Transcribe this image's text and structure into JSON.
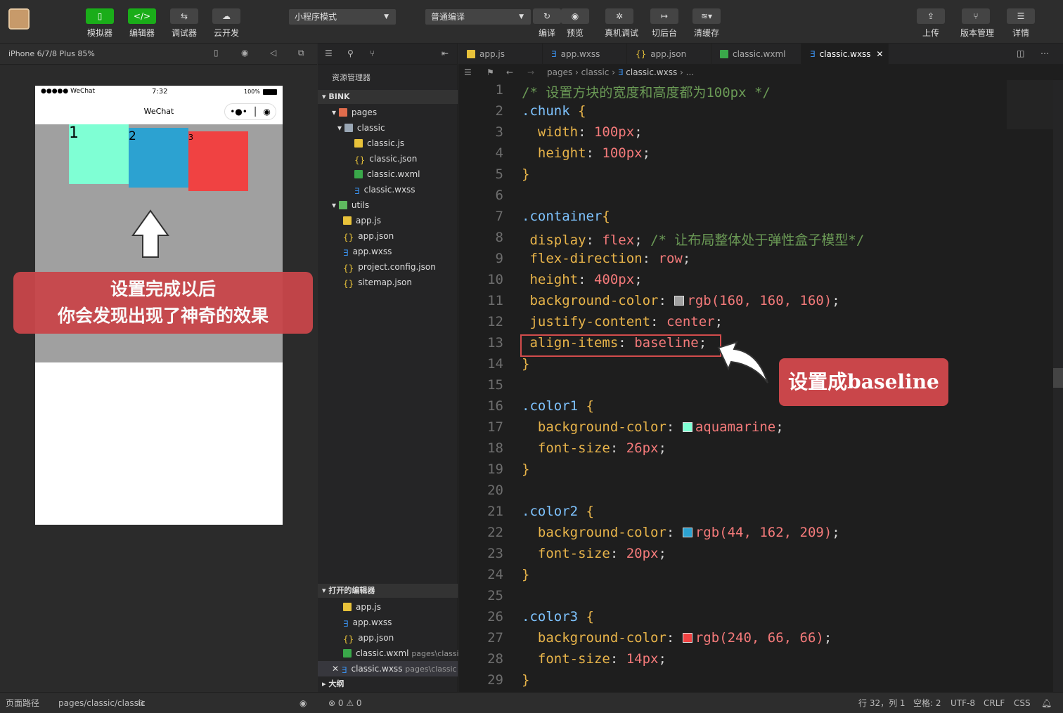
{
  "toolbar": {
    "simulator": "模拟器",
    "editor": "编辑器",
    "debugger": "调试器",
    "cloud": "云开发",
    "mode": "小程序模式",
    "compile": "普通编译",
    "compile_btn": "编译",
    "preview": "预览",
    "real_debug": "真机调试",
    "background": "切后台",
    "clear_cache": "清缓存",
    "upload": "上传",
    "version": "版本管理",
    "details": "详情"
  },
  "sim": {
    "device": "iPhone 6/7/8 Plus 85%",
    "status_left": "●●●●● WeChat",
    "time": "7:32",
    "battery": "100%",
    "nav_title": "WeChat",
    "blocks": [
      {
        "label": "1"
      },
      {
        "label": "2"
      },
      {
        "label": "3"
      }
    ],
    "banner_line1": "设置完成以后",
    "banner_line2": "你会发现出现了神奇的效果"
  },
  "explorer": {
    "title": "资源管理器",
    "project": "BINK",
    "tree": [
      "pages",
      "classic",
      "classic.js",
      "classic.json",
      "classic.wxml",
      "classic.wxss",
      "utils",
      "app.js",
      "app.json",
      "app.wxss",
      "project.config.json",
      "sitemap.json"
    ],
    "open_editors_title": "打开的编辑器",
    "open_editors": [
      "app.js",
      "app.wxss",
      "app.json",
      "classic.wxml",
      "classic.wxss"
    ],
    "open_hint": "pages\\classic",
    "outline": "大纲"
  },
  "tabs": [
    "app.js",
    "app.wxss",
    "app.json",
    "classic.wxml",
    "classic.wxss"
  ],
  "crumb": [
    "pages",
    "classic",
    "classic.wxss",
    "..."
  ],
  "code": {
    "l1": "/* 设置方块的宽度和高度都为100px */",
    "l2a": ".chunk",
    "l2b": " {",
    "l3p": "width",
    "l3v": "100px",
    "l4p": "height",
    "l4v": "100px",
    "close": "}",
    "l7a": ".container",
    "l7b": "{",
    "l8p": "display",
    "l8v": "flex",
    "l8c": "/* 让布局整体处于弹性盒子模型*/",
    "l9p": "flex-direction",
    "l9v": "row",
    "l10p": "height",
    "l10v": "400px",
    "l11p": "background-color",
    "l11v": "rgb(160, 160, 160)",
    "l12p": "justify-content",
    "l12v": "center",
    "l13p": "align-items",
    "l13v": "baseline",
    "l16": ".color1",
    "l17p": "background-color",
    "l17v": "aquamarine",
    "l18p": "font-size",
    "l18v": "26px",
    "l21": ".color2",
    "l22p": "background-color",
    "l22v": "rgb(44, 162, 209)",
    "l23p": "font-size",
    "l23v": "20px",
    "l26": ".color3",
    "l27p": "background-color",
    "l27v": "rgb(240, 66, 66)",
    "l28p": "font-size",
    "l28v": "14px",
    "lines": [
      "1",
      "2",
      "3",
      "4",
      "5",
      "6",
      "7",
      "8",
      "9",
      "10",
      "11",
      "12",
      "13",
      "14",
      "15",
      "16",
      "17",
      "18",
      "19",
      "20",
      "21",
      "22",
      "23",
      "24",
      "25",
      "26",
      "27",
      "28",
      "29"
    ]
  },
  "callout": "设置成baseline",
  "status": {
    "path_label": "页面路径",
    "path": "pages/classic/classic",
    "errors": "⊗ 0 ⚠ 0",
    "cursor": "行 32，列 1",
    "spaces": "空格: 2",
    "encoding": "UTF-8",
    "eol": "CRLF",
    "lang": "CSS"
  },
  "colors": {
    "aquamarine": "#7fffd4",
    "blue": "#2ca2d1",
    "red": "#f04242",
    "gray": "#a0a0a0"
  }
}
